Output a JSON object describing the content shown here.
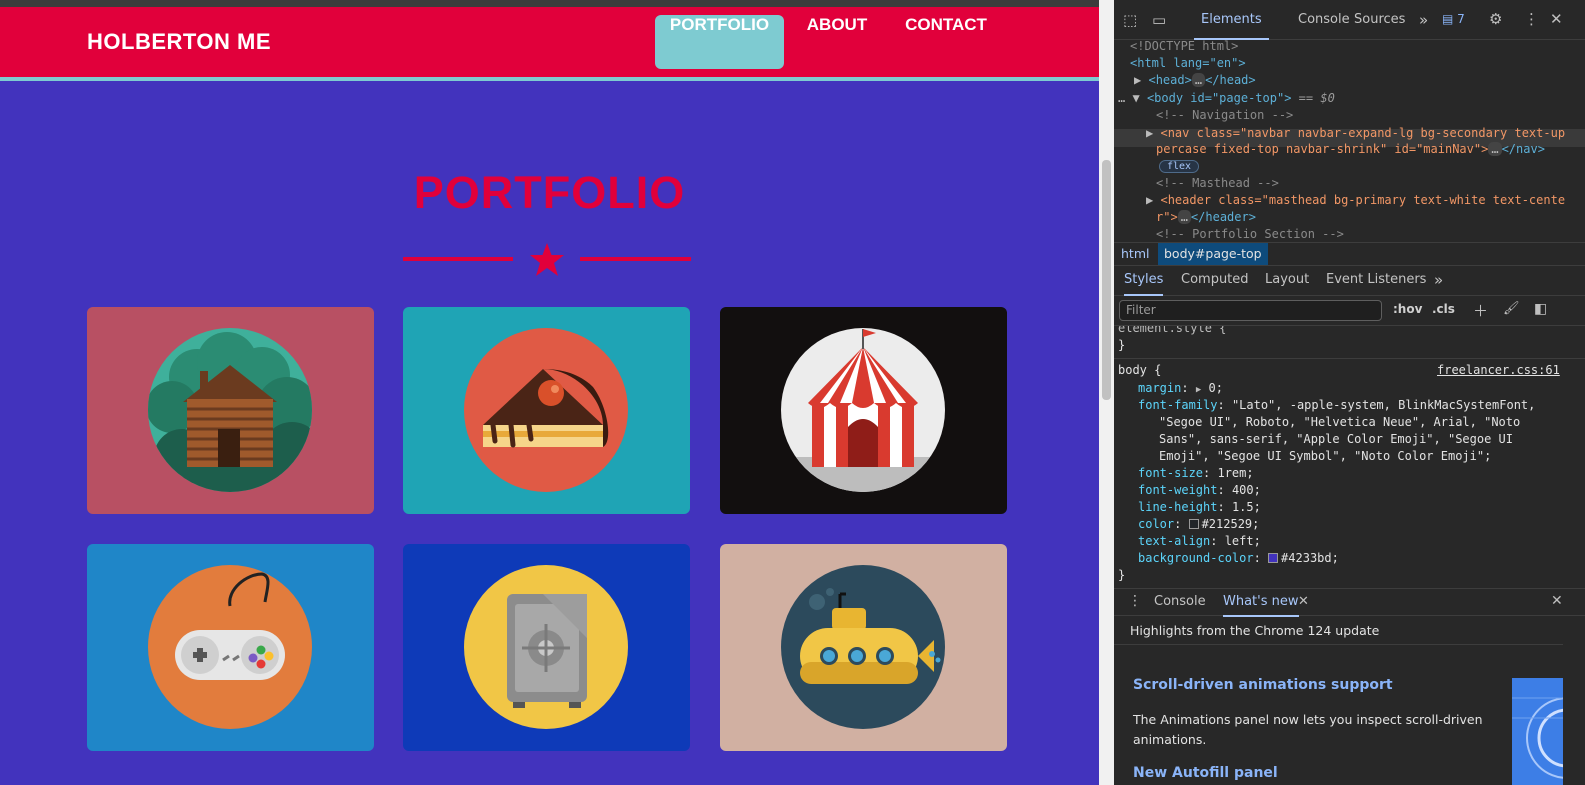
{
  "page": {
    "brand": "HOLBERTON ME",
    "nav": {
      "portfolio": "PORTFOLIO",
      "about": "ABOUT",
      "contact": "CONTACT"
    },
    "heading": "PORTFOLIO",
    "tiles": [
      {
        "name": "cabin",
        "bg": "#b85063"
      },
      {
        "name": "cake",
        "bg": "#1fa4b5"
      },
      {
        "name": "circus",
        "bg": "#120f0f"
      },
      {
        "name": "game",
        "bg": "#1f86c8"
      },
      {
        "name": "safe",
        "bg": "#0e3ab8"
      },
      {
        "name": "submarine",
        "bg": "#d1b0a2"
      }
    ],
    "colors": {
      "primary": "#e1003b",
      "accent": "#7ecbd1",
      "background": "#4233bd"
    }
  },
  "devtools": {
    "tabs": {
      "elements": "Elements",
      "console": "Console",
      "sources": "Sources",
      "more": "»",
      "badge": "7"
    },
    "dom": {
      "doctype": "<!DOCTYPE html>",
      "html_open": "<html lang=\"en\">",
      "head_prefix": "<head>",
      "head_suffix": "</head>",
      "body_tag": "<body id=\"page-top\">",
      "body_eq": "== $0",
      "comment_nav": "<!-- Navigation -->",
      "nav_line1": "<nav class=\"navbar navbar-expand-lg bg-secondary text-up",
      "nav_line2": "percase fixed-top navbar-shrink\" id=\"mainNav\">",
      "nav_close": "</nav>",
      "flex_badge": "flex",
      "comment_masthead": "<!-- Masthead -->",
      "header_line1": "<header class=\"masthead bg-primary text-white text-cente",
      "header_line2": "r\">",
      "header_close": "</header>",
      "comment_portfolio": "<!-- Portfolio Section -->"
    },
    "breadcrumb": {
      "html": "html",
      "body": "body#page-top"
    },
    "styles_tabs": {
      "styles": "Styles",
      "computed": "Computed",
      "layout": "Layout",
      "listeners": "Event Listeners",
      "more": "»"
    },
    "filter_placeholder": "Filter",
    "filter_tools": {
      "hov": ":hov",
      "cls": ".cls"
    },
    "rules": {
      "element_style": "element.style {",
      "close1": "}",
      "body_selector": "body {",
      "source": "freelancer.css:61",
      "margin_prop": "margin",
      "margin_val": "0;",
      "ff_prop": "font-family",
      "ff_val1": "\"Lato\", -apple-system, BlinkMacSystemFont,",
      "ff_val2": "\"Segoe UI\", Roboto, \"Helvetica Neue\", Arial, \"Noto",
      "ff_val3": "Sans\", sans-serif, \"Apple Color Emoji\", \"Segoe UI",
      "ff_val4": "Emoji\", \"Segoe UI Symbol\", \"Noto Color Emoji\";",
      "fs_prop": "font-size",
      "fs_val": "1rem;",
      "fw_prop": "font-weight",
      "fw_val": "400;",
      "lh_prop": "line-height",
      "lh_val": "1.5;",
      "color_prop": "color",
      "color_val": "#212529;",
      "ta_prop": "text-align",
      "ta_val": "left;",
      "bg_prop": "background-color",
      "bg_val": "#4233bd;",
      "close2": "}",
      "color_swatch": "#212529",
      "bg_swatch": "#4233bd"
    },
    "drawer": {
      "console": "Console",
      "whats_new": "What's new",
      "highlights": "Highlights from the Chrome 124 update",
      "item1_title": "Scroll-driven animations support",
      "item1_body1": "The Animations panel now lets you inspect scroll-driven",
      "item1_body2": "animations.",
      "item2_title": "New Autofill panel"
    }
  }
}
